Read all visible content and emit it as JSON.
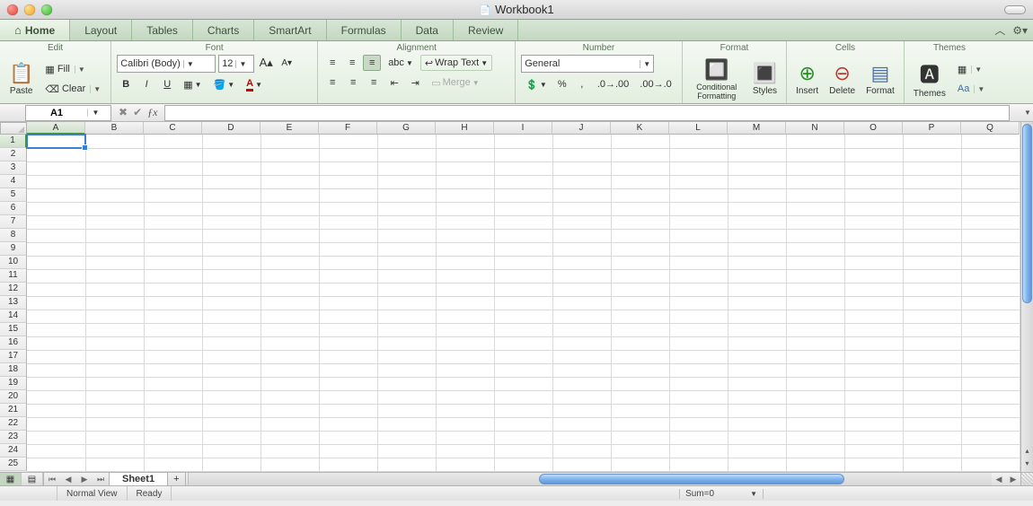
{
  "window": {
    "title": "Workbook1"
  },
  "tabs": [
    "Home",
    "Layout",
    "Tables",
    "Charts",
    "SmartArt",
    "Formulas",
    "Data",
    "Review"
  ],
  "active_tab": "Home",
  "groups": {
    "edit": {
      "title": "Edit",
      "paste": "Paste",
      "fill": "Fill",
      "clear": "Clear"
    },
    "font": {
      "title": "Font",
      "name": "Calibri (Body)",
      "size": "12",
      "bold": "B",
      "italic": "I",
      "underline": "U"
    },
    "alignment": {
      "title": "Alignment",
      "wrap": "Wrap Text",
      "merge": "Merge",
      "abc": "abc"
    },
    "number": {
      "title": "Number",
      "format": "General",
      "percent": "%",
      "comma": ","
    },
    "format": {
      "title": "Format",
      "cond": "Conditional Formatting",
      "styles": "Styles"
    },
    "cells": {
      "title": "Cells",
      "insert": "Insert",
      "delete": "Delete",
      "format": "Format"
    },
    "themes": {
      "title": "Themes",
      "themes": "Themes",
      "aa": "Aa"
    }
  },
  "namebox": "A1",
  "columns": [
    "A",
    "B",
    "C",
    "D",
    "E",
    "F",
    "G",
    "H",
    "I",
    "J",
    "K",
    "L",
    "M",
    "N",
    "O",
    "P",
    "Q"
  ],
  "rows": 25,
  "selected_cell": {
    "row": 1,
    "col": "A"
  },
  "sheet_tabs": [
    "Sheet1"
  ],
  "status": {
    "view": "Normal View",
    "state": "Ready",
    "sum": "Sum=0"
  }
}
